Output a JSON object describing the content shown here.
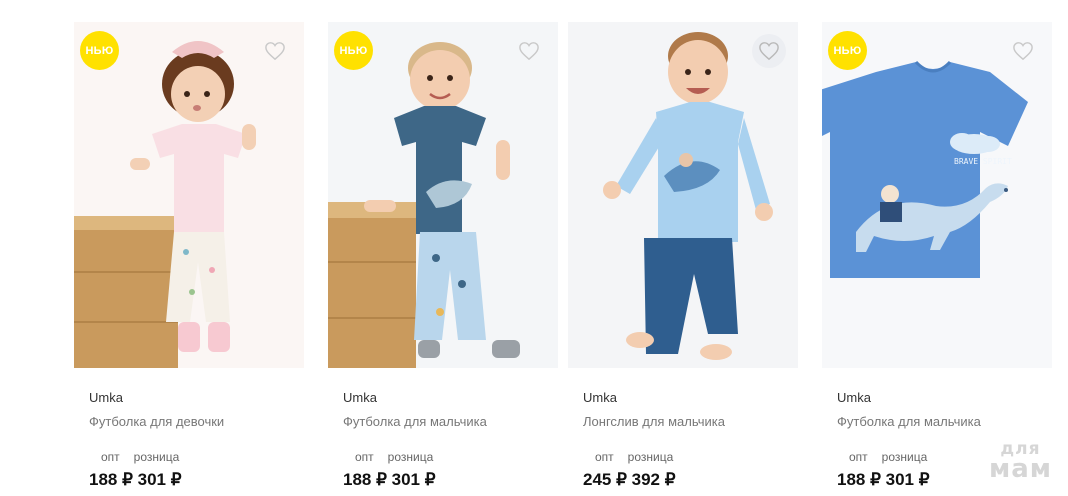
{
  "products": [
    {
      "badge": "НЬЮ",
      "brand": "Umka",
      "title": "Футболка для девочки",
      "price_labels": [
        "опт",
        "розница"
      ],
      "prices": "188 ₽ 301 ₽",
      "image": "girl-pink-tshirt-photo"
    },
    {
      "badge": "НЬЮ",
      "brand": "Umka",
      "title": "Футболка для мальчика",
      "price_labels": [
        "опт",
        "розница"
      ],
      "prices": "188 ₽ 301 ₽",
      "image": "boy-navy-tshirt-photo"
    },
    {
      "badge": "",
      "brand": "Umka",
      "title": "Лонгслив для мальчика",
      "price_labels": [
        "опт",
        "розница"
      ],
      "prices": "245 ₽ 392 ₽",
      "image": "boy-blue-longsleeve-photo"
    },
    {
      "badge": "НЬЮ",
      "brand": "Umka",
      "title": "Футболка для мальчика",
      "price_labels": [
        "опт",
        "розница"
      ],
      "prices": "188 ₽ 301 ₽",
      "image": "blue-tshirt-product-photo"
    }
  ],
  "tshirt_print": "BRAVE SPIRIT",
  "watermark": {
    "line1": "для",
    "line2": "мам"
  },
  "colors": {
    "badge": "#ffe100",
    "heart": "#c9c9c9"
  }
}
